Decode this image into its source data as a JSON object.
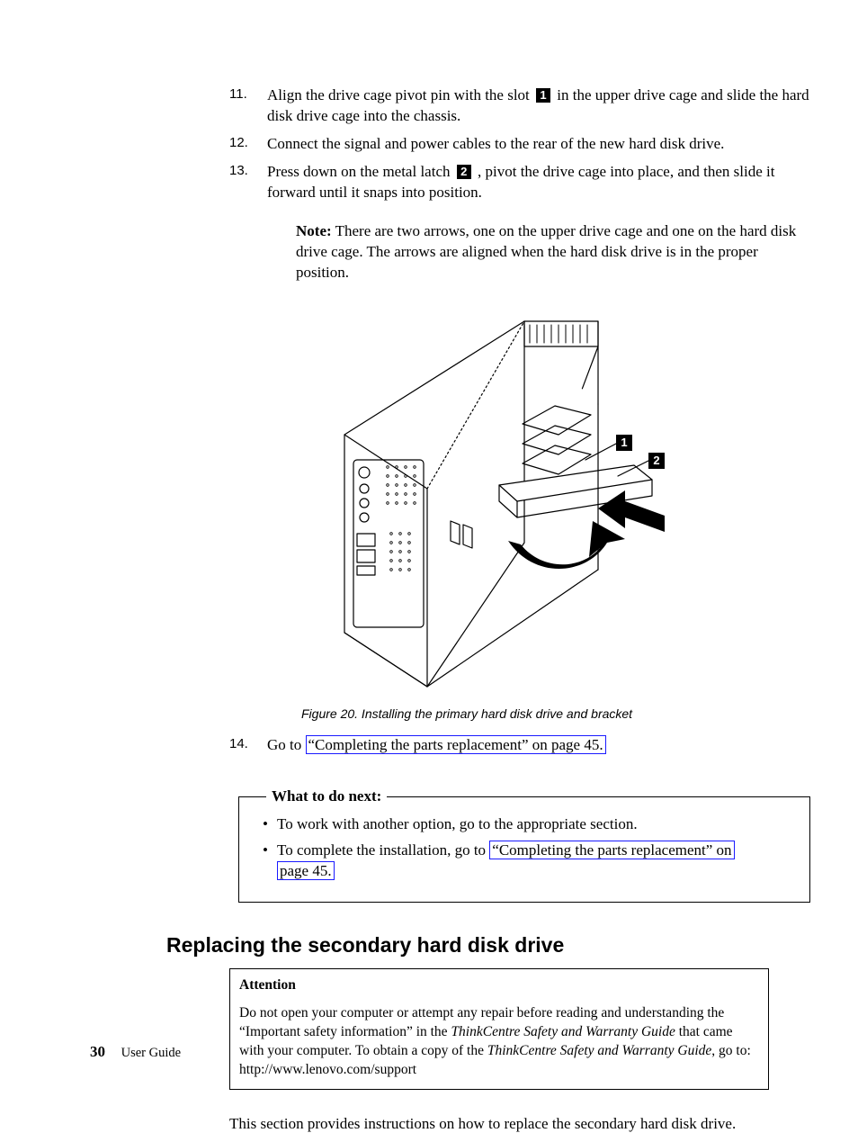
{
  "steps": {
    "s11": {
      "num": "11.",
      "a": "Align the drive cage pivot pin with the slot ",
      "co": "1",
      "b": " in the upper drive cage and slide the hard disk drive cage into the chassis."
    },
    "s12": {
      "num": "12.",
      "text": "Connect the signal and power cables to the rear of the new hard disk drive."
    },
    "s13": {
      "num": "13.",
      "a": "Press down on the metal latch ",
      "co": "2",
      "b": " , pivot the drive cage into place, and then slide it forward until it snaps into position."
    },
    "s14": {
      "num": "14.",
      "a": "Go to ",
      "link": "“Completing the parts replacement” on page 45."
    }
  },
  "note": {
    "label": "Note:",
    "body": "There are two arrows, one on the upper drive cage and one on the hard disk drive cage. The arrows are aligned when the hard disk drive is in the proper position."
  },
  "figure": {
    "c1": "1",
    "c2": "2",
    "caption": "Figure 20. Installing the primary hard disk drive and bracket"
  },
  "nextbox": {
    "legend": "What to do next:",
    "i1": "To work with another option, go to the appropriate section.",
    "i2a": "To complete the installation, go to ",
    "i2link": "“Completing the parts replacement” on",
    "i2link2": "page 45."
  },
  "section": {
    "heading": "Replacing the secondary hard disk drive",
    "att_label": "Attention",
    "att_a": "Do not open your computer or attempt any repair before reading and understanding the “Important safety information” in the ",
    "att_i1": "ThinkCentre Safety and Warranty Guide",
    "att_b": " that came with your computer. To obtain a copy of the ",
    "att_i2": "ThinkCentre Safety and Warranty Guide",
    "att_c": ", go to:",
    "att_url": "http://www.lenovo.com/support",
    "intro": "This section provides instructions on how to replace the secondary hard disk drive."
  },
  "footer": {
    "page": "30",
    "title": "User Guide"
  }
}
